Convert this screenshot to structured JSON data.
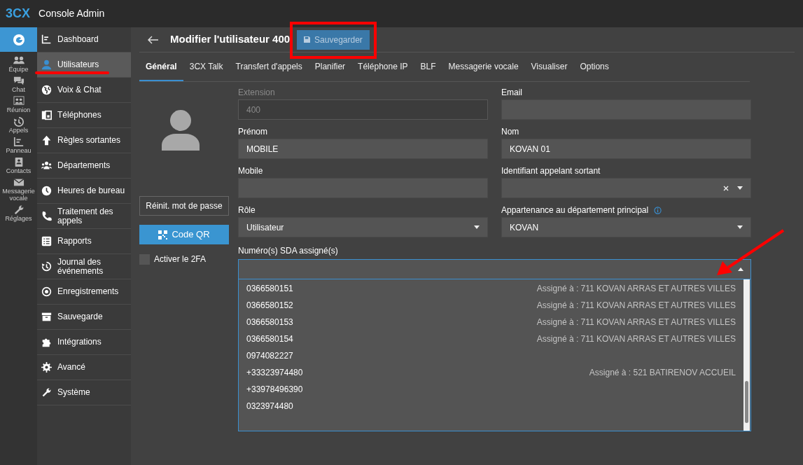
{
  "app": {
    "logo": "3CX",
    "title": "Console Admin"
  },
  "rail": [
    {
      "label": "Équipe"
    },
    {
      "label": "Chat"
    },
    {
      "label": "Réunion"
    },
    {
      "label": "Appels"
    },
    {
      "label": "Panneau"
    },
    {
      "label": "Contacts"
    },
    {
      "label": "Messagerie vocale"
    },
    {
      "label": "Réglages"
    }
  ],
  "nav": [
    {
      "label": "Dashboard",
      "selected": false
    },
    {
      "label": "Utilisateurs",
      "selected": true
    },
    {
      "label": "Voix & Chat",
      "selected": false
    },
    {
      "label": "Téléphones",
      "selected": false
    },
    {
      "label": "Règles sortantes",
      "selected": false
    },
    {
      "label": "Départements",
      "selected": false
    },
    {
      "label": "Heures de bureau",
      "selected": false
    },
    {
      "label": "Traitement des appels",
      "selected": false
    },
    {
      "label": "Rapports",
      "selected": false
    },
    {
      "label": "Journal des événements",
      "selected": false
    },
    {
      "label": "Enregistrements",
      "selected": false
    },
    {
      "label": "Sauvegarde",
      "selected": false
    },
    {
      "label": "Intégrations",
      "selected": false
    },
    {
      "label": "Avancé",
      "selected": false
    },
    {
      "label": "Système",
      "selected": false
    }
  ],
  "header": {
    "title": "Modifier l'utilisateur 400",
    "save_button": "Sauvegarder"
  },
  "tabs": [
    {
      "label": "Général",
      "selected": true
    },
    {
      "label": "3CX Talk",
      "selected": false
    },
    {
      "label": "Transfert d'appels",
      "selected": false
    },
    {
      "label": "Planifier",
      "selected": false
    },
    {
      "label": "Téléphone IP",
      "selected": false
    },
    {
      "label": "BLF",
      "selected": false
    },
    {
      "label": "Messagerie vocale",
      "selected": false
    },
    {
      "label": "Visualiser",
      "selected": false
    },
    {
      "label": "Options",
      "selected": false
    }
  ],
  "profile": {
    "reset_button": "Réinit. mot de passe",
    "qr_button": "Code QR",
    "twofa": {
      "label": "Activer le 2FA",
      "checked": false
    }
  },
  "fields": [
    {
      "label": "Extension",
      "value": "400",
      "kind": "text",
      "disabled": true
    },
    {
      "label": "Email",
      "kind": "text",
      "disabled": false
    },
    {
      "label": "Prénom",
      "value": "MOBILE",
      "kind": "text",
      "disabled": false
    },
    {
      "label": "Nom",
      "value": "KOVAN 01",
      "kind": "text",
      "disabled": false
    },
    {
      "label": "Mobile",
      "kind": "text",
      "disabled": false
    },
    {
      "label": "Identifiant appelant sortant",
      "kind": "clearable-select",
      "disabled": false
    },
    {
      "label": "Rôle",
      "value": "Utilisateur",
      "kind": "select",
      "disabled": false
    },
    {
      "label": "Appartenance au département principal",
      "value": "KOVAN",
      "kind": "select",
      "info": true,
      "disabled": false
    }
  ],
  "sda": {
    "label": "Numéro(s) SDA assigné(s)",
    "expanded": true,
    "options": [
      {
        "number": "0366580151",
        "assigned": "Assigné à : 711 KOVAN ARRAS ET AUTRES VILLES"
      },
      {
        "number": "0366580152",
        "assigned": "Assigné à : 711 KOVAN ARRAS ET AUTRES VILLES"
      },
      {
        "number": "0366580153",
        "assigned": "Assigné à : 711 KOVAN ARRAS ET AUTRES VILLES"
      },
      {
        "number": "0366580154",
        "assigned": "Assigné à : 711 KOVAN ARRAS ET AUTRES VILLES"
      },
      {
        "number": "0974082227"
      },
      {
        "number": "+33323974480",
        "assigned": "Assigné à : 521 BATIRENOV ACCUEIL"
      },
      {
        "number": "+33978496390"
      },
      {
        "number": "0323974480"
      }
    ]
  }
}
